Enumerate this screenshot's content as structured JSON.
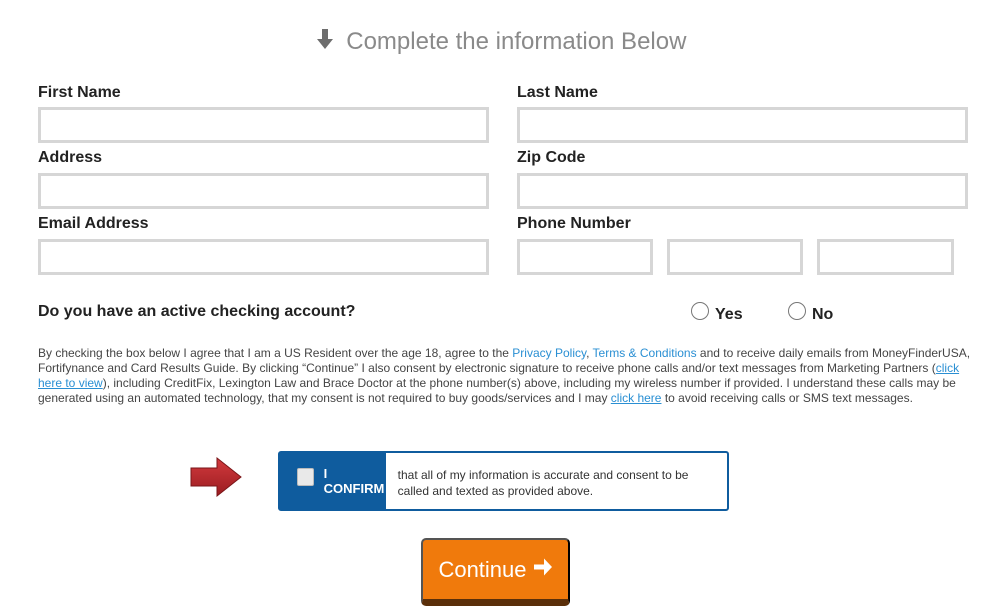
{
  "heading": {
    "text": "Complete the information Below",
    "icon": "arrow-down-icon"
  },
  "fields": {
    "first_name": {
      "label": "First Name",
      "value": ""
    },
    "last_name": {
      "label": "Last Name",
      "value": ""
    },
    "address": {
      "label": "Address",
      "value": ""
    },
    "zip_code": {
      "label": "Zip Code",
      "value": ""
    },
    "email": {
      "label": "Email Address",
      "value": ""
    },
    "phone": {
      "label": "Phone Number",
      "area": "",
      "prefix": "",
      "line": ""
    }
  },
  "checking_question": {
    "text": "Do you have an active checking account?",
    "options": [
      "Yes",
      "No"
    ]
  },
  "disclaimer": {
    "part1": "By checking the box below I agree that I am a US Resident over the age 18, agree to the ",
    "privacy_link": "Privacy Policy",
    "comma": ", ",
    "terms_link": "Terms & Conditions",
    "part2": " and to receive daily emails from MoneyFinderUSA, Fortifynance and Card Results Guide. By clicking “Continue” I also consent by electronic signature to receive phone calls and/or text messages from Marketing Partners (",
    "view_link": "click here to view",
    "part3": "), including CreditFix, Lexington Law and Brace Doctor at the phone number(s) above, including my wireless number if provided. I understand these calls may be generated using an automated technology, that my consent is not required to buy goods/services and I may ",
    "avoid_link": "click here",
    "part4": " to avoid receiving calls or SMS text messages."
  },
  "confirm": {
    "label": "I CONFIRM",
    "text": "that all of my information is accurate and consent to be called and texted as provided above."
  },
  "continue_button": {
    "label": "Continue",
    "icon": "arrow-right-icon"
  },
  "colors": {
    "accent_blue": "#0f5c9e",
    "button_orange": "#f07a0c",
    "link_blue": "#2a8fd3",
    "arrow_red": "#b8252a"
  }
}
